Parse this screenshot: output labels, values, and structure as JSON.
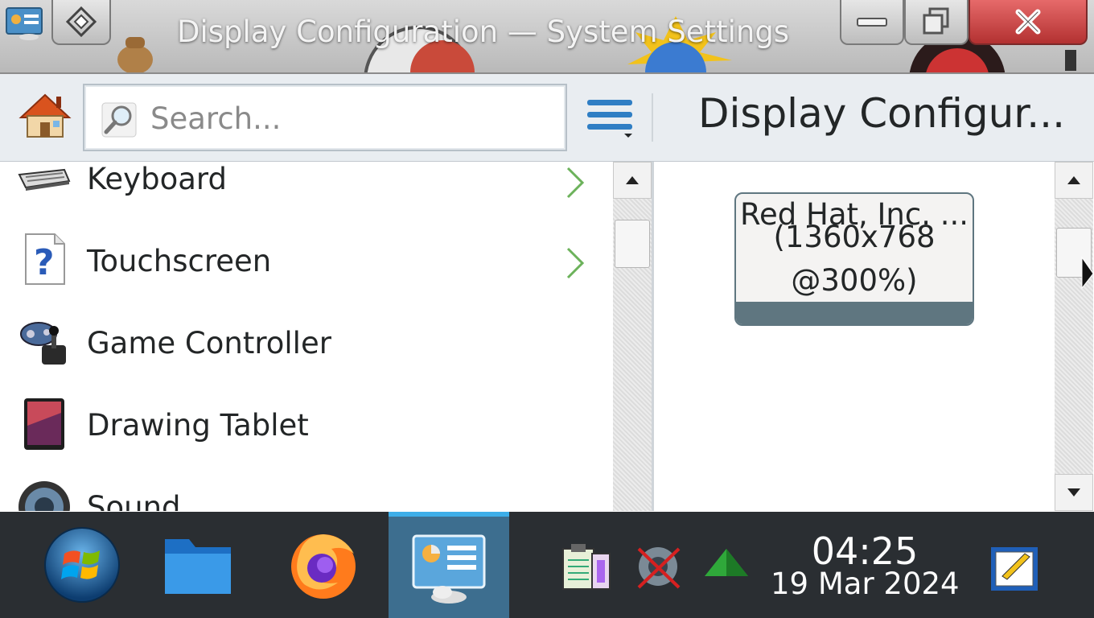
{
  "window": {
    "title": "Display Configuration — System Settings"
  },
  "toolbar": {
    "search_placeholder": "Search...",
    "page_title": "Display Configur..."
  },
  "sidebar": {
    "items": [
      {
        "label": "Keyboard",
        "has_submenu": true
      },
      {
        "label": "Touchscreen",
        "has_submenu": true
      },
      {
        "label": "Game Controller",
        "has_submenu": false
      },
      {
        "label": "Drawing Tablet",
        "has_submenu": false
      },
      {
        "label": "Sound",
        "has_submenu": false
      }
    ]
  },
  "display": {
    "monitor_name": "Red Hat, Inc. ...",
    "resolution": "(1360x768",
    "scale": "@300%)"
  },
  "taskbar": {
    "clock_time": "04:25",
    "clock_date": "19 Mar 2024"
  },
  "colors": {
    "accent": "#3daee9",
    "taskbar_bg": "#2a2e32",
    "active_task": "#3d6e8f",
    "monitor_border": "#5f7680",
    "chevron": "#6cb25b"
  }
}
